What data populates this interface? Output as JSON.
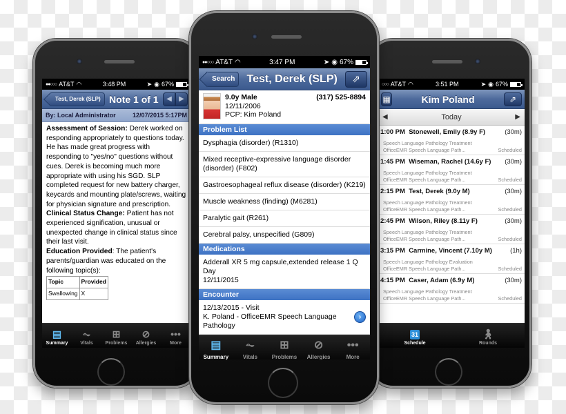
{
  "left_phone": {
    "status": {
      "carrier": "AT&T",
      "time": "3:48 PM",
      "battery": "67%"
    },
    "nav": {
      "back_label": "Test, Derek (SLP)",
      "title": "Note 1 of 1",
      "prev_icon": "◀",
      "next_icon": "▶"
    },
    "note_header": {
      "author": "By: Local Administrator",
      "datetime": "12/07/2015  5:17PM"
    },
    "note": {
      "assessment_label": "Assessment of Session:",
      "assessment_text": " Derek worked on responding appropriately to questions today. He has made great progress with responding to \"yes/no\" questions without cues. Derek is becoming much more appropriate with using his SGD. SLP completed request for new battery charger, keycards and mounting plate/screws, waiting for physician signature and prescription.",
      "clinical_label": "Clinical Status Change:",
      "clinical_text": " Patient has not experienced signification, unusual or unexpected change in clinical status since their last visit.",
      "education_label": "Education Provided",
      "education_text": ": The patient's parents/guardian was educated on the following topic(s):",
      "table": {
        "headers": [
          "Topic",
          "Provided"
        ],
        "rows": [
          [
            "Swallowing",
            "X"
          ]
        ]
      }
    },
    "tabs": [
      {
        "label": "Summary",
        "icon": "clipboard-icon"
      },
      {
        "label": "Vitals",
        "icon": "pulse-icon"
      },
      {
        "label": "Problems",
        "icon": "medkit-icon"
      },
      {
        "label": "Allergies",
        "icon": "no-icon"
      },
      {
        "label": "More",
        "icon": "more-icon"
      }
    ]
  },
  "center_phone": {
    "status": {
      "carrier": "AT&T",
      "time": "3:47 PM",
      "battery": "67%"
    },
    "nav": {
      "back_label": "Search",
      "title": "Test, Derek (SLP)"
    },
    "patient": {
      "age_sex": "9.0y Male",
      "phone": "(317) 525-8894",
      "dob": "12/11/2006",
      "pcp": "PCP: Kim Poland"
    },
    "problem_list": {
      "title": "Problem List",
      "items": [
        "Dysphagia (disorder) (R1310)",
        "Mixed receptive-expressive language disorder (disorder) (F802)",
        "Gastroesophageal reflux disease (disorder) (K219)",
        "Muscle weakness (finding) (M6281)",
        "Paralytic gait (R261)",
        "Cerebral palsy, unspecified (G809)"
      ]
    },
    "medications": {
      "title": "Medications",
      "items": [
        {
          "name": "Adderall XR 5 mg capsule,extended release 1 Q Day",
          "date": "12/11/2015"
        }
      ]
    },
    "encounter": {
      "title": "Encounter",
      "items": [
        {
          "line1": "12/13/2015 - Visit",
          "line2": "K. Poland - OfficeEMR Speech Language Pathology"
        }
      ]
    },
    "tabs": [
      {
        "label": "Summary",
        "icon": "clipboard-icon"
      },
      {
        "label": "Vitals",
        "icon": "pulse-icon"
      },
      {
        "label": "Problems",
        "icon": "medkit-icon"
      },
      {
        "label": "Allergies",
        "icon": "no-icon"
      },
      {
        "label": "More",
        "icon": "more-icon"
      }
    ]
  },
  "right_phone": {
    "status": {
      "carrier": "AT&T",
      "time": "3:51 PM",
      "battery": "67%"
    },
    "nav": {
      "title": "Kim Poland"
    },
    "date_label": "Today",
    "appointments": [
      {
        "time": "1:00 PM",
        "patient": "Stonewell, Emily (8.9y F)",
        "duration": "(30m)",
        "type": "Speech Language Pathology Treatment",
        "location": "OfficeEMR Speech Language Path...",
        "status": "Scheduled"
      },
      {
        "time": "1:45 PM",
        "patient": "Wiseman, Rachel (14.6y F)",
        "duration": "(30m)",
        "type": "Speech Language Pathology Treatment",
        "location": "OfficeEMR Speech Language Path...",
        "status": "Scheduled"
      },
      {
        "time": "2:15 PM",
        "patient": "Test, Derek (9.0y M)",
        "duration": "(30m)",
        "type": "Speech Language Pathology Treatment",
        "location": "OfficeEMR Speech Language Path...",
        "status": "Scheduled"
      },
      {
        "time": "2:45 PM",
        "patient": "Wilson, Riley (8.11y F)",
        "duration": "(30m)",
        "type": "Speech Language Pathology Treatment",
        "location": "OfficeEMR Speech Language Path...",
        "status": "Scheduled"
      },
      {
        "time": "3:15 PM",
        "patient": "Carmine, Vincent (7.10y M)",
        "duration": "(1h)",
        "type": "Speech Language Pathology Evaluation",
        "location": "OfficeEMR Speech Language Path...",
        "status": "Scheduled"
      },
      {
        "time": "4:15 PM",
        "patient": "Caser, Adam (6.9y M)",
        "duration": "(30m)",
        "type": "Speech Language Pathology Treatment",
        "location": "OfficeEMR Speech Language Path...",
        "status": "Scheduled"
      }
    ],
    "tabs": [
      {
        "label": "Schedule",
        "icon": "calendar-icon",
        "calendar_day": "31"
      },
      {
        "label": "Rounds",
        "icon": "walking-icon"
      }
    ]
  }
}
